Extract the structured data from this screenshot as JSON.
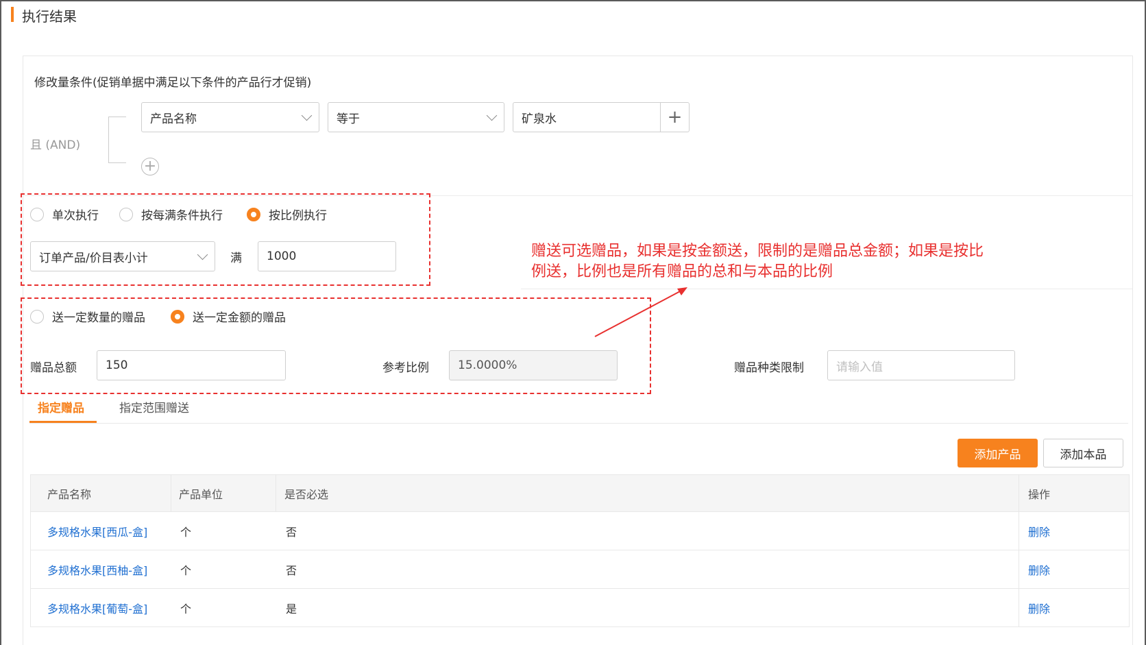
{
  "page": {
    "title": "执行结果"
  },
  "condition": {
    "section_title": "修改量条件(促销单据中满足以下条件的产品行才促销)",
    "logic_label": "且 (AND)",
    "field": "产品名称",
    "operator": "等于",
    "value": "矿泉水",
    "add_symbol": "+",
    "add_row_symbol": "+"
  },
  "execution": {
    "options": [
      {
        "label": "单次执行",
        "selected": false
      },
      {
        "label": "按每满条件执行",
        "selected": false
      },
      {
        "label": "按比例执行",
        "selected": true
      }
    ],
    "basis_select": "订单产品/价目表小计",
    "full_label": "满",
    "full_value": "1000"
  },
  "gift": {
    "options": [
      {
        "label": "送一定数量的赠品",
        "selected": false
      },
      {
        "label": "送一定金额的赠品",
        "selected": true
      }
    ],
    "total_label": "赠品总额",
    "total_value": "150",
    "ratio_label": "参考比例",
    "ratio_value": "15.0000%",
    "kind_limit_label": "赠品种类限制",
    "kind_limit_placeholder": "请输入值"
  },
  "annotation": {
    "line1": "赠送可选赠品，如果是按金额送，限制的是赠品总金额；如果是按比",
    "line2": "例送，比例也是所有赠品的总和与本品的比例",
    "color": "#e8302f"
  },
  "tabs": [
    {
      "label": "指定赠品",
      "active": true
    },
    {
      "label": "指定范围赠送",
      "active": false
    }
  ],
  "actions": {
    "add_product": "添加产品",
    "add_self": "添加本品"
  },
  "table": {
    "headers": [
      "产品名称",
      "产品单位",
      "是否必选",
      "操作"
    ],
    "rows": [
      {
        "name": "多规格水果[西瓜-盒]",
        "unit": "个",
        "required": "否",
        "action": "删除"
      },
      {
        "name": "多规格水果[西柚-盒]",
        "unit": "个",
        "required": "否",
        "action": "删除"
      },
      {
        "name": "多规格水果[葡萄-盒]",
        "unit": "个",
        "required": "是",
        "action": "删除"
      }
    ]
  },
  "colors": {
    "accent": "#f7821e",
    "link": "#1f6fd1",
    "annotation": "#e8302f"
  }
}
